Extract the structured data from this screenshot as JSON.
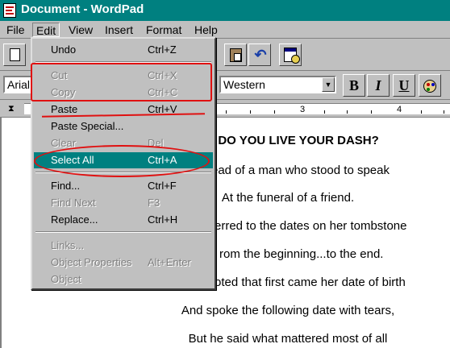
{
  "window": {
    "title": "Document - WordPad"
  },
  "menubar": {
    "items": [
      {
        "label": "File"
      },
      {
        "label": "Edit"
      },
      {
        "label": "View"
      },
      {
        "label": "Insert"
      },
      {
        "label": "Format"
      },
      {
        "label": "Help"
      }
    ]
  },
  "format_bar": {
    "font_name": "Arial",
    "script": "Western",
    "bold_label": "B",
    "italic_label": "I",
    "underline_label": "U"
  },
  "ruler": {
    "labels": [
      "3",
      "4"
    ]
  },
  "edit_menu": {
    "items": [
      {
        "label": "Undo",
        "shortcut": "Ctrl+Z",
        "enabled": true
      },
      {
        "label": "Cut",
        "shortcut": "Ctrl+X",
        "enabled": false
      },
      {
        "label": "Copy",
        "shortcut": "Ctrl+C",
        "enabled": false
      },
      {
        "label": "Paste",
        "shortcut": "Ctrl+V",
        "enabled": true
      },
      {
        "label": "Paste Special...",
        "shortcut": "",
        "enabled": true
      },
      {
        "label": "Clear",
        "shortcut": "Del",
        "enabled": false
      },
      {
        "label": "Select All",
        "shortcut": "Ctrl+A",
        "enabled": true,
        "highlighted": true
      },
      {
        "label": "Find...",
        "shortcut": "Ctrl+F",
        "enabled": true
      },
      {
        "label": "Find Next",
        "shortcut": "F3",
        "enabled": false
      },
      {
        "label": "Replace...",
        "shortcut": "Ctrl+H",
        "enabled": true
      },
      {
        "label": "Links...",
        "shortcut": "",
        "enabled": false
      },
      {
        "label": "Object Properties",
        "shortcut": "Alt+Enter",
        "enabled": false
      },
      {
        "label": "Object",
        "shortcut": "",
        "enabled": false
      }
    ],
    "highlight_color": "#008080",
    "annotation_color": "#e01010"
  },
  "document": {
    "lines": [
      "W DO YOU LIVE YOUR DASH?",
      "ead of a man who stood to speak",
      "At the funeral of a friend.",
      "erred to the dates on her tombstone",
      "rom the beginning...to the end.",
      "oted that first came her date of birth",
      "And spoke the following date with tears,",
      "But he said what mattered most of all"
    ]
  }
}
